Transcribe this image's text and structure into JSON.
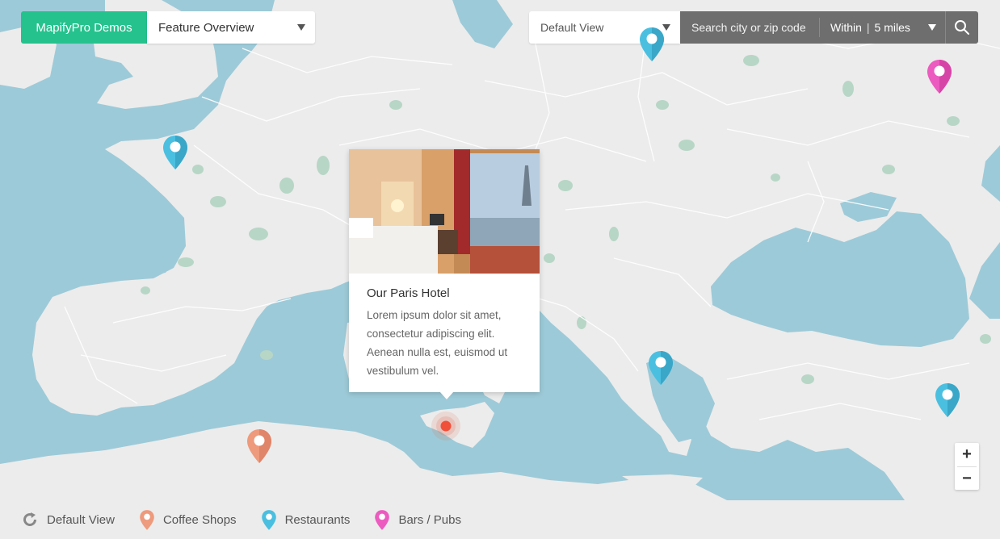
{
  "brand": {
    "label": "MapifyPro Demos",
    "accent": "#26c28e"
  },
  "feature_select": {
    "value": "Feature Overview"
  },
  "view_select": {
    "value": "Default View"
  },
  "search": {
    "placeholder": "Search city or zip code",
    "within_label": "Within",
    "radius": "5 miles"
  },
  "popup": {
    "title": "Our Paris Hotel",
    "body": "Lorem ipsum dolor sit amet, consectetur adipiscing elit. Aenean nulla est, euismod ut vestibulum vel."
  },
  "markers": [
    {
      "category": "Restaurants",
      "color": "#4bbfe0"
    },
    {
      "category": "Restaurants",
      "color": "#4bbfe0"
    },
    {
      "category": "Restaurants",
      "color": "#4bbfe0"
    },
    {
      "category": "Restaurants",
      "color": "#4bbfe0"
    },
    {
      "category": "Bars / Pubs",
      "color": "#ec5bbf"
    },
    {
      "category": "Coffee Shops",
      "color": "#ee9a7c"
    }
  ],
  "zoom": {
    "in": "+",
    "out": "−"
  },
  "legend": [
    {
      "label": "Default View",
      "icon": "refresh-icon"
    },
    {
      "label": "Coffee Shops",
      "icon": "coffee-pin-icon",
      "color": "#ee9a7c"
    },
    {
      "label": "Restaurants",
      "icon": "restaurant-pin-icon",
      "color": "#4bbfe0"
    },
    {
      "label": "Bars / Pubs",
      "icon": "bar-pin-icon",
      "color": "#ec5bbf"
    }
  ],
  "colors": {
    "sea": "#9dcad8",
    "land": "#ececec",
    "forest": "#b7d6c6"
  }
}
